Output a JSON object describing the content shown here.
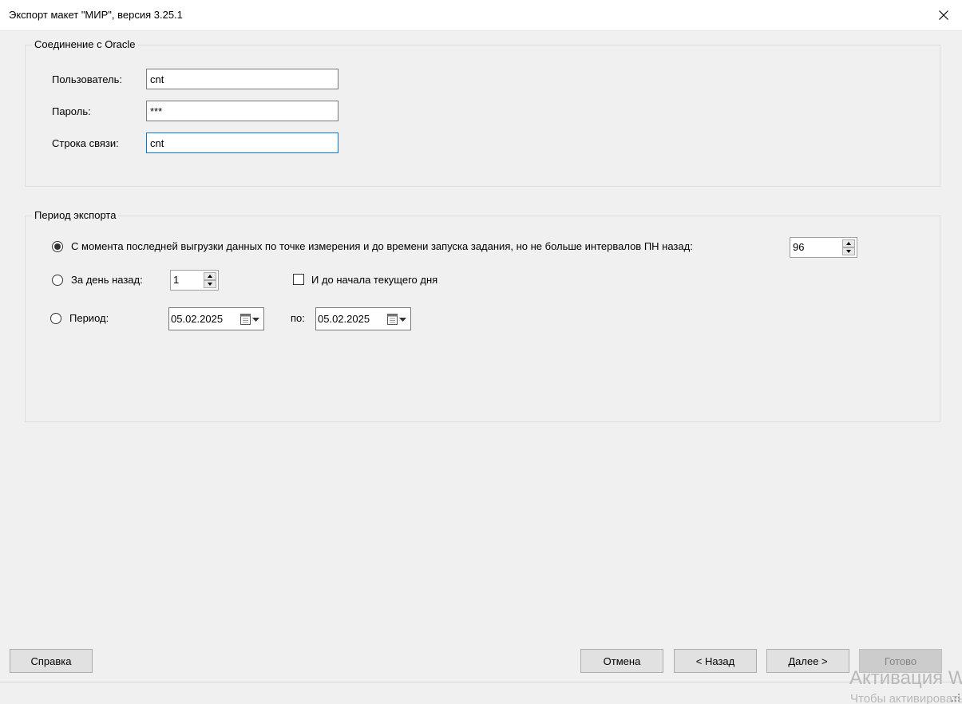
{
  "window": {
    "title": "Экспорт макет \"МИР\", версия 3.25.1"
  },
  "oracle": {
    "legend": "Соединение с Oracle",
    "user_label": "Пользователь:",
    "user_value": "cnt",
    "password_label": "Пароль:",
    "password_value": "***",
    "conn_label": "Строка связи:",
    "conn_value": "cnt"
  },
  "period": {
    "legend": "Период экспорта",
    "option_last": {
      "label": "С момента  последней выгрузки данных по точке измерения и до времени запуска задания, но не больше интервалов ПН назад:",
      "selected": true,
      "intervals_value": "96"
    },
    "option_day": {
      "label": "За день назад:",
      "selected": false,
      "days_value": "1",
      "checkbox_label": "И до начала текущего дня",
      "checkbox_checked": false
    },
    "option_range": {
      "label": "Период:",
      "selected": false,
      "from_date": "05.02.2025",
      "to_label": "по:",
      "to_date": "05.02.2025"
    }
  },
  "buttons": {
    "help": "Справка",
    "cancel": "Отмена",
    "back": "< Назад",
    "next": "Далее >",
    "finish": "Готово"
  },
  "watermark": {
    "line1": "Активация Windows",
    "line2": "Чтобы активировать Windows, перейдите в раздел «Параметры»."
  },
  "icons": {
    "close": "close-icon",
    "calendar": "calendar-icon",
    "dropdown": "chevron-down-icon",
    "grip": "resize-grip-icon"
  }
}
